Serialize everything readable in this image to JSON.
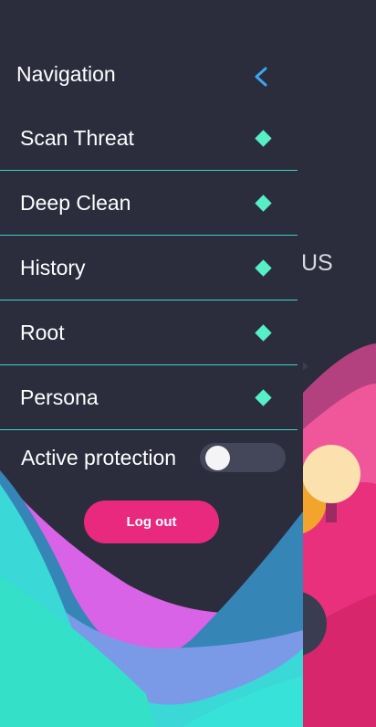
{
  "navigation": {
    "title": "Navigation",
    "back_icon": "chevron-left-icon"
  },
  "menu": {
    "items": [
      {
        "label": "Scan Threat",
        "icon": "diamond-icon"
      },
      {
        "label": "Deep Clean",
        "icon": "diamond-icon"
      },
      {
        "label": "History",
        "icon": "diamond-icon"
      },
      {
        "label": "Root",
        "icon": "diamond-icon"
      },
      {
        "label": "Persona",
        "icon": "diamond-icon"
      }
    ]
  },
  "protection": {
    "label": "Active protection",
    "enabled": false
  },
  "logout": {
    "label": "Log out"
  },
  "background": {
    "partial_text": "US"
  },
  "colors": {
    "background": "#2b2d3d",
    "accent_blue": "#3aa6f0",
    "divider": "#3fd1c6",
    "diamond": "#56efc6",
    "logout": "#e8297e"
  }
}
